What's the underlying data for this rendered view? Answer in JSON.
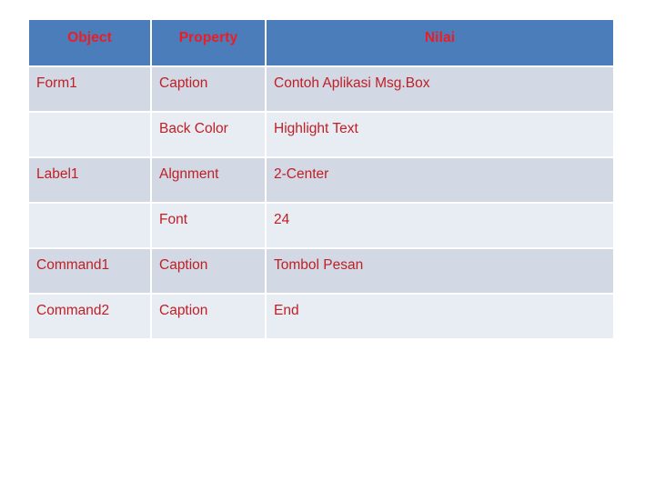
{
  "table": {
    "columns": [
      {
        "key": "object",
        "label": "Object"
      },
      {
        "key": "property",
        "label": "Property"
      },
      {
        "key": "nilai",
        "label": "Nilai"
      }
    ],
    "rows": [
      {
        "object": "Form1",
        "property": "Caption",
        "nilai": "Contoh Aplikasi Msg.Box"
      },
      {
        "object": "",
        "property": "Back Color",
        "nilai": "Highlight Text"
      },
      {
        "object": "Label1",
        "property": "Algnment",
        "nilai": "2-Center"
      },
      {
        "object": "",
        "property": "Font",
        "nilai": "24"
      },
      {
        "object": "Command1",
        "property": "Caption",
        "nilai": "Tombol Pesan"
      },
      {
        "object": "Command2",
        "property": "Caption",
        "nilai": "End"
      }
    ]
  },
  "colors": {
    "header_background": "#4a7dba",
    "header_text": "#ee1c24",
    "body_text": "#bf2026",
    "row_dark": "#d2d8e4",
    "row_light": "#e8ecf3",
    "page_background": "#ffffff"
  }
}
